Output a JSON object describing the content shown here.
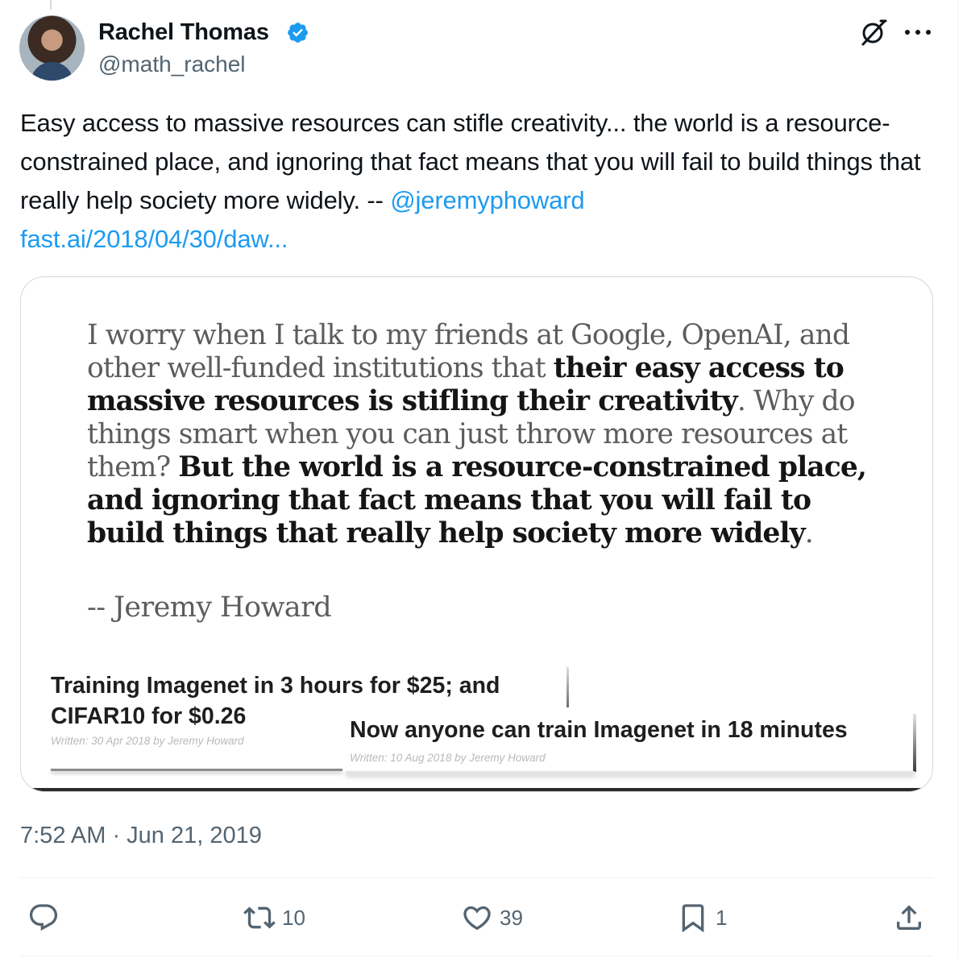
{
  "author": {
    "name": "Rachel Thomas",
    "handle": "@math_rachel"
  },
  "tweet": {
    "text_before": "Easy access to massive resources can stifle creativity... the world is a resource-constrained place, and ignoring that fact means that you will fail to build things that really help society more widely. -- ",
    "mention": "@jeremyphoward",
    "url": "fast.ai/2018/04/30/daw..."
  },
  "media": {
    "quote": {
      "p1": "I worry when I talk to my friends at Google, OpenAI, and other well-funded institutions that ",
      "b1": "their easy access to massive resources is stifling their creativity",
      "p2": ". Why do things smart when you can just throw more resources at them? ",
      "b2": "But the world is a resource-constrained place, and ignoring that fact means that you will fail to build things that really help society more widely",
      "p3": "."
    },
    "attribution": "-- Jeremy Howard",
    "post1": {
      "title": "Training Imagenet in 3 hours for $25; and CIFAR10 for $0.26",
      "meta": "Written: 30 Apr 2018 by Jeremy Howard"
    },
    "post2": {
      "title": "Now anyone can train Imagenet in 18 minutes",
      "meta": "Written: 10 Aug 2018 by Jeremy Howard"
    }
  },
  "timestamp": "7:52 AM · Jun 21, 2019",
  "actions": {
    "reply": "",
    "retweet": "10",
    "like": "39",
    "bookmark": "1"
  },
  "icons": [
    "verified-badge",
    "grok",
    "more",
    "reply",
    "retweet",
    "like",
    "bookmark",
    "share"
  ],
  "colors": {
    "link": "#1d9bf0",
    "secondary_text": "#536471",
    "verified": "#1d9bf0"
  }
}
